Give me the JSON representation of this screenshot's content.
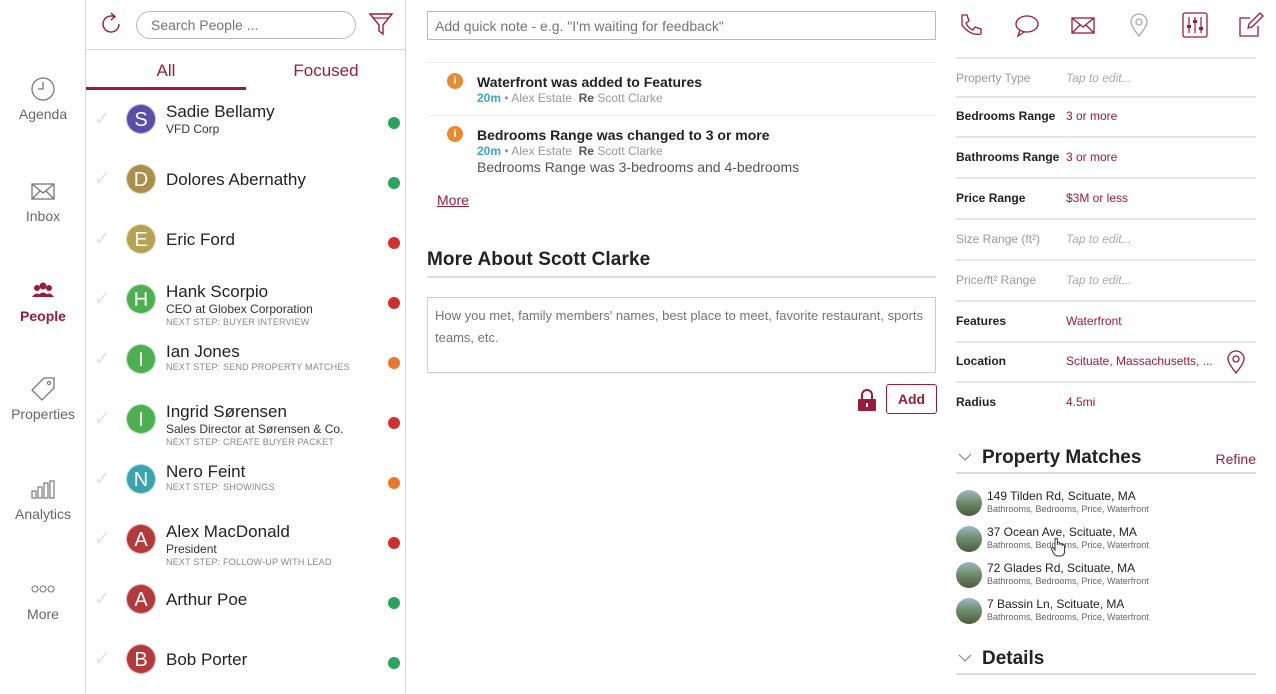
{
  "nav": {
    "items": [
      {
        "label": "Agenda",
        "icon": "clock-icon"
      },
      {
        "label": "Inbox",
        "icon": "envelope-icon"
      },
      {
        "label": "People",
        "icon": "people-icon",
        "active": true
      },
      {
        "label": "Properties",
        "icon": "tag-icon"
      },
      {
        "label": "Analytics",
        "icon": "bar-chart-icon"
      },
      {
        "label": "More",
        "icon": "ellipsis-icon"
      }
    ]
  },
  "people": {
    "search_placeholder": "Search People ...",
    "tabs": {
      "all": "All",
      "focused": "Focused"
    },
    "list": [
      {
        "initial": "S",
        "name": "Sadie Bellamy",
        "sub": "VFD Corp",
        "next": "",
        "avatar_color": "#5a4fa8",
        "status_color": "#27a55a"
      },
      {
        "initial": "D",
        "name": "Dolores Abernathy",
        "sub": "",
        "next": "",
        "avatar_color": "#a8904a",
        "status_color": "#27a55a"
      },
      {
        "initial": "E",
        "name": "Eric Ford",
        "sub": "",
        "next": "",
        "avatar_color": "#b7a252",
        "status_color": "#d0312d"
      },
      {
        "initial": "H",
        "name": "Hank Scorpio",
        "sub": "CEO at Globex Corporation",
        "next": "Next Step: Buyer Interview",
        "avatar_color": "#4caf50",
        "status_color": "#d0312d"
      },
      {
        "initial": "I",
        "name": "Ian Jones",
        "sub": "",
        "next": "Next Step: Send Property Matches",
        "avatar_color": "#4caf50",
        "status_color": "#e9782e"
      },
      {
        "initial": "I",
        "name": "Ingrid Sørensen",
        "sub": "Sales Director at Sørensen & Co.",
        "next": "Next Step: Create Buyer Packet",
        "avatar_color": "#4caf50",
        "status_color": "#d0312d"
      },
      {
        "initial": "N",
        "name": "Nero Feint",
        "sub": "",
        "next": "Next Step: Showings",
        "avatar_color": "#3ba3ad",
        "status_color": "#e9782e"
      },
      {
        "initial": "A",
        "name": "Alex MacDonald",
        "sub": "President",
        "next": "Next Step: Follow-Up With Lead",
        "avatar_color": "#b23a3a",
        "status_color": "#d0312d"
      },
      {
        "initial": "A",
        "name": "Arthur Poe",
        "sub": "",
        "next": "",
        "avatar_color": "#b23a3a",
        "status_color": "#27a55a"
      },
      {
        "initial": "B",
        "name": "Bob Porter",
        "sub": "",
        "next": "",
        "avatar_color": "#b23a3a",
        "status_color": "#27a55a"
      }
    ]
  },
  "quick_note_placeholder": "Add quick note - e.g. \"I'm waiting for feedback\"",
  "activity": [
    {
      "title": "Waterfront was added to Features",
      "time": "20m",
      "by": "• Alex Estate",
      "re_label": "Re",
      "re": "Scott Clarke",
      "desc": ""
    },
    {
      "title": "Bedrooms Range was changed to 3 or more",
      "time": "20m",
      "by": "• Alex Estate",
      "re_label": "Re",
      "re": "Scott Clarke",
      "desc": "Bedrooms Range was 3-bedrooms and 4-bedrooms"
    }
  ],
  "more_label": "More",
  "about": {
    "title": "More About Scott Clarke",
    "placeholder": "How you met, family members' names, best place to meet, favorite restaurant, sports teams, etc.",
    "add_label": "Add"
  },
  "properties": [
    {
      "key": "Property Type",
      "value": "Tap to edit...",
      "key_bold": false,
      "tap": true
    },
    {
      "key": "Bedrooms Range",
      "value": "3 or more",
      "key_bold": true,
      "tap": false
    },
    {
      "key": "Bathrooms Range",
      "value": "3 or more",
      "key_bold": true,
      "tap": false
    },
    {
      "key": "Price Range",
      "value": "$3M or less",
      "key_bold": true,
      "tap": false
    },
    {
      "key": "Size Range (ft²)",
      "value": "Tap to edit...",
      "key_bold": false,
      "tap": true
    },
    {
      "key": "Price/ft² Range",
      "value": "Tap to edit...",
      "key_bold": false,
      "tap": true
    },
    {
      "key": "Features",
      "value": "Waterfront",
      "key_bold": true,
      "tap": false
    },
    {
      "key": "Location",
      "value": "Scituate, Massachusetts, ...",
      "key_bold": true,
      "tap": false
    },
    {
      "key": "Radius",
      "value": "4.5mi",
      "key_bold": true,
      "tap": false
    }
  ],
  "matches": {
    "title": "Property Matches",
    "refine_label": "Refine",
    "items": [
      {
        "address": "149 Tilden Rd, Scituate, MA",
        "tags": "Bathrooms, Bedrooms, Price, Waterfront"
      },
      {
        "address": "37 Ocean Ave, Scituate, MA",
        "tags": "Bathrooms, Bedrooms, Price, Waterfront"
      },
      {
        "address": "72 Glades Rd, Scituate, MA",
        "tags": "Bathrooms, Bedrooms, Price, Waterfront"
      },
      {
        "address": "7 Bassin Ln, Scituate, MA",
        "tags": "Bathrooms, Bedrooms, Price, Waterfront"
      }
    ]
  },
  "details": {
    "title": "Details"
  },
  "colors": {
    "accent": "#9b1b3a",
    "time": "#3aa6c9",
    "info": "#e88a2d"
  }
}
